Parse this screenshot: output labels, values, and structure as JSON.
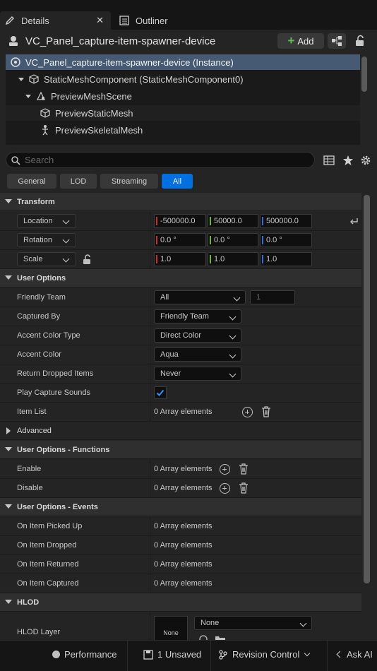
{
  "tabs": {
    "details": "Details",
    "outliner": "Outliner",
    "close_glyph": "✕"
  },
  "actor": {
    "title": "VC_Panel_capture-item-spawner-device",
    "add_label": "Add"
  },
  "tree": [
    {
      "label": "VC_Panel_capture-item-spawner-device (Instance)",
      "icon": "actor-icon",
      "selected": true
    },
    {
      "label": "StaticMeshComponent (StaticMeshComponent0)",
      "icon": "static-mesh-icon"
    },
    {
      "label": "PreviewMeshScene",
      "icon": "scene-icon"
    },
    {
      "label": "PreviewStaticMesh",
      "icon": "static-mesh-icon"
    },
    {
      "label": "PreviewSkeletalMesh",
      "icon": "skeletal-mesh-icon"
    }
  ],
  "search": {
    "placeholder": "Search"
  },
  "filters": [
    "General",
    "LOD",
    "Streaming",
    "All"
  ],
  "transform": {
    "category": "Transform",
    "location": {
      "label": "Location",
      "x": "-500000.0",
      "y": "50000.0",
      "z": "500000.0"
    },
    "rotation": {
      "label": "Rotation",
      "x": "0.0 °",
      "y": "0.0 °",
      "z": "0.0 °"
    },
    "scale": {
      "label": "Scale",
      "x": "1.0",
      "y": "1.0",
      "z": "1.0"
    }
  },
  "user_options": {
    "category": "User Options",
    "friendly_team": {
      "label": "Friendly Team",
      "value": "All",
      "number": "1"
    },
    "captured_by": {
      "label": "Captured By",
      "value": "Friendly Team"
    },
    "accent_color_type": {
      "label": "Accent Color Type",
      "value": "Direct Color"
    },
    "accent_color": {
      "label": "Accent Color",
      "value": "Aqua"
    },
    "return_dropped": {
      "label": "Return Dropped Items",
      "value": "Never"
    },
    "play_capture": {
      "label": "Play Capture Sounds",
      "checked": true
    },
    "item_list": {
      "label": "Item List",
      "value": "0 Array elements"
    }
  },
  "advanced": "Advanced",
  "functions": {
    "category": "User Options - Functions",
    "enable": {
      "label": "Enable",
      "value": "0 Array elements"
    },
    "disable": {
      "label": "Disable",
      "value": "0 Array elements"
    }
  },
  "events": {
    "category": "User Options - Events",
    "picked_up": {
      "label": "On Item Picked Up",
      "value": "0 Array elements"
    },
    "dropped": {
      "label": "On Item Dropped",
      "value": "0 Array elements"
    },
    "returned": {
      "label": "On Item Returned",
      "value": "0 Array elements"
    },
    "captured": {
      "label": "On Item Captured",
      "value": "0 Array elements"
    }
  },
  "hlod": {
    "category": "HLOD",
    "layer": {
      "label": "HLOD Layer",
      "thumb": "None",
      "value": "None"
    }
  },
  "status": {
    "performance": "Performance",
    "unsaved": "1 Unsaved",
    "revision": "Revision Control",
    "ask_ai": "Ask AI"
  },
  "colors": {
    "x_axis": "#c8302a",
    "y_axis": "#6fb52a",
    "z_axis": "#2f6fd6",
    "accent": "#0070e0"
  }
}
